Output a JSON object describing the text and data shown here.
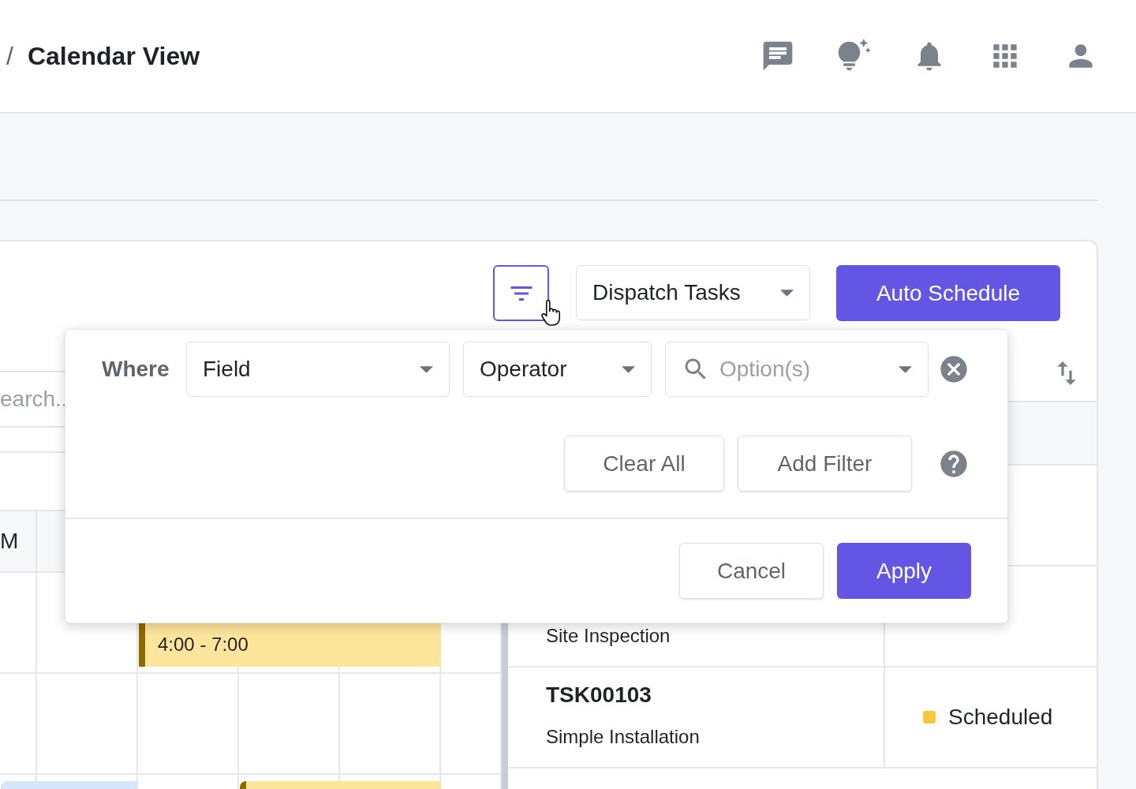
{
  "breadcrumb": {
    "separator": "/",
    "current": "Calendar View"
  },
  "toolbar": {
    "dispatch_select": {
      "value": "Dispatch Tasks"
    },
    "auto_schedule": "Auto Schedule",
    "filter_active": true
  },
  "calendar": {
    "search": {
      "placeholder": "earch.."
    },
    "header_cell": "M",
    "events": [
      {
        "label": "4:00 - 7:00",
        "color": "#fee59c"
      },
      {
        "color": "#d6e6fb"
      },
      {
        "color": "#fee59c"
      }
    ]
  },
  "tasks": {
    "rows": [
      {
        "name": "Site Inspection"
      },
      {
        "id": "TSK00103",
        "name": "Simple Installation",
        "status": "Scheduled",
        "color": "#f9c93a"
      }
    ]
  },
  "filter_popover": {
    "where": "Where",
    "field": {
      "value": "Field"
    },
    "operator": {
      "value": "Operator"
    },
    "options": {
      "placeholder": "Option(s)"
    },
    "clear_all": "Clear All",
    "add_filter": "Add Filter",
    "cancel": "Cancel",
    "apply": "Apply"
  }
}
